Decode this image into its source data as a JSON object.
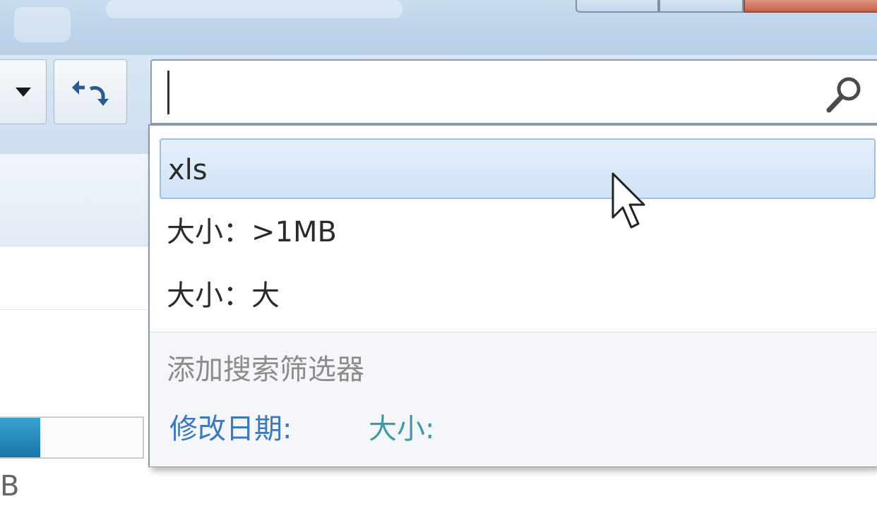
{
  "search": {
    "value": "",
    "placeholder": ""
  },
  "suggestions": [
    {
      "label": "xls",
      "selected": true
    },
    {
      "label": "大小：>1MB",
      "selected": false
    },
    {
      "label": "大小：大",
      "selected": false
    }
  ],
  "filters": {
    "title": "添加搜索筛选器",
    "date_label": "修改日期:",
    "size_label": "大小:"
  },
  "left_pane": {
    "partial_text": "B",
    "progress_fraction": 0.28
  },
  "icons": {
    "dropdown": "chevron-down-icon",
    "refresh": "refresh-icon",
    "search": "search-icon",
    "cursor": "mouse-cursor-icon"
  },
  "colors": {
    "selection": "#cfe2f7",
    "link_date": "#3a78c0",
    "link_size": "#3f9aa6",
    "progress": "#1676a8"
  }
}
